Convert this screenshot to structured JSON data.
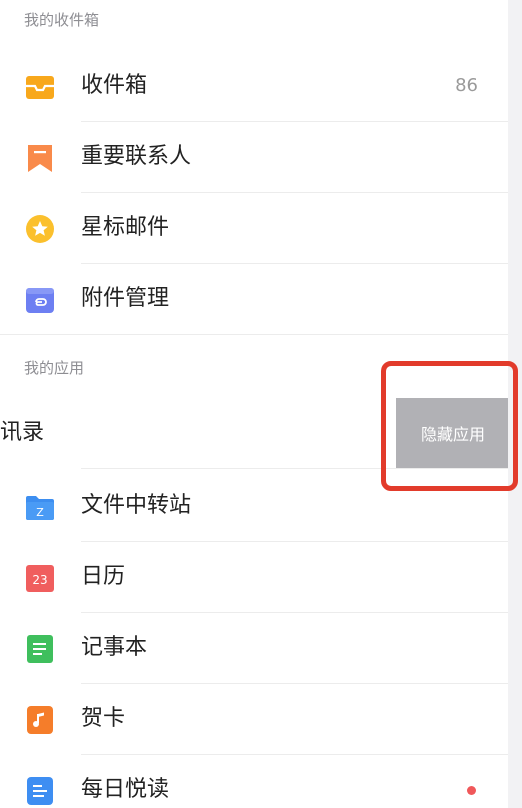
{
  "sections": {
    "mailbox_header": "我的收件箱",
    "apps_header": "我的应用"
  },
  "mailbox": {
    "inbox": {
      "label": "收件箱",
      "count": "86",
      "icon": "inbox-icon",
      "color": "#f8a81c"
    },
    "important_contacts": {
      "label": "重要联系人",
      "icon": "bookmark-icon",
      "color": "#f98a4a"
    },
    "starred": {
      "label": "星标邮件",
      "icon": "star-icon",
      "color": "#fbc02d"
    },
    "attachments": {
      "label": "附件管理",
      "icon": "attachment-icon",
      "color": "#6d7ff2"
    }
  },
  "apps": {
    "contacts_partial": {
      "label": "讯录"
    },
    "hide_action": "隐藏应用",
    "file_transfer": {
      "label": "文件中转站",
      "icon": "folder-icon",
      "icon_text": "Z",
      "color": "#3d8ef0"
    },
    "calendar": {
      "label": "日历",
      "icon": "calendar-icon",
      "icon_text": "23",
      "color": "#f05e5e"
    },
    "notepad": {
      "label": "记事本",
      "icon": "notepad-icon",
      "color": "#3fbf5d"
    },
    "greeting_card": {
      "label": "贺卡",
      "icon": "music-card-icon",
      "color": "#f57d2a"
    },
    "daily_reading": {
      "label": "每日悦读",
      "icon": "book-icon",
      "color": "#3e8ef2",
      "has_new": true
    }
  }
}
